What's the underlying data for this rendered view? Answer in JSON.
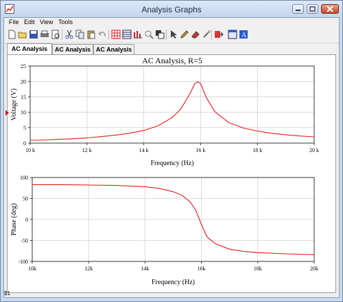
{
  "window": {
    "title": "Analysis Graphs",
    "app_icon": "chart-app-icon"
  },
  "window_controls": [
    "minimize-icon",
    "maximize-icon",
    "close-icon"
  ],
  "menu": {
    "items": [
      "File",
      "Edit",
      "View",
      "Tools"
    ]
  },
  "toolbar": {
    "icons": [
      "new-icon",
      "open-icon",
      "save-icon",
      "print-icon",
      "print-preview-icon",
      "cut-icon",
      "copy-icon",
      "paste-icon",
      "undo-icon",
      "grid-icon",
      "table-icon",
      "bar-chart-icon",
      "zoom-icon",
      "copy-graph-icon",
      "pointer-icon",
      "pencil-icon",
      "erase-icon",
      "tools-icon",
      "export-icon",
      "window-icon",
      "help-icon"
    ]
  },
  "tabs": [
    {
      "label": "AC Analysis",
      "active": true
    },
    {
      "label": "AC Analysis",
      "active": false
    },
    {
      "label": "AC Analysis",
      "active": false
    }
  ],
  "status": {
    "text": "$1"
  },
  "colors": {
    "trace": "#e01a1a",
    "grid": "#d0d0d0",
    "marker": "#d01010"
  },
  "chart_data": [
    {
      "type": "line",
      "title": "AC Analysis, R=5",
      "xlabel": "Frequency (Hz)",
      "ylabel": "Voltage (V)",
      "xlim": [
        10000,
        20000
      ],
      "ylim": [
        0,
        25
      ],
      "x_ticks": [
        "10 k",
        "12 k",
        "14 k",
        "16 k",
        "18 k",
        "20 k"
      ],
      "y_ticks": [
        "0",
        "5",
        "10",
        "15",
        "20",
        "25"
      ],
      "grid": true,
      "series": [
        {
          "x": [
            10000,
            10500,
            11000,
            11500,
            12000,
            12500,
            13000,
            13500,
            14000,
            14500,
            15000,
            15300,
            15600,
            15800,
            15900,
            16000,
            16200,
            16500,
            17000,
            17500,
            18000,
            18500,
            19000,
            19500,
            20000
          ],
          "values": [
            0.9,
            1.0,
            1.2,
            1.4,
            1.7,
            2.1,
            2.6,
            3.2,
            4.1,
            5.6,
            8.3,
            11.0,
            15.6,
            19.3,
            19.9,
            19.3,
            14.8,
            10.2,
            6.6,
            4.9,
            3.9,
            3.2,
            2.7,
            2.3,
            2.0
          ]
        }
      ]
    },
    {
      "type": "line",
      "title": "",
      "xlabel": "Frequency (Hz)",
      "ylabel": "Phase (deg)",
      "xlim": [
        10000,
        20000
      ],
      "ylim": [
        -100,
        100
      ],
      "x_ticks": [
        "10k",
        "12k",
        "14k",
        "16k",
        "18k",
        "20k"
      ],
      "y_ticks": [
        "100",
        "50",
        "0",
        "-50",
        "-100"
      ],
      "grid": true,
      "series": [
        {
          "x": [
            10000,
            11000,
            12000,
            13000,
            14000,
            14500,
            15000,
            15300,
            15600,
            15800,
            15900,
            16000,
            16200,
            16500,
            17000,
            17500,
            18000,
            19000,
            20000
          ],
          "values": [
            83,
            83,
            82,
            81,
            78,
            74,
            66,
            58,
            42,
            22,
            5,
            -12,
            -42,
            -58,
            -71,
            -76,
            -79,
            -82,
            -84
          ]
        }
      ]
    }
  ]
}
